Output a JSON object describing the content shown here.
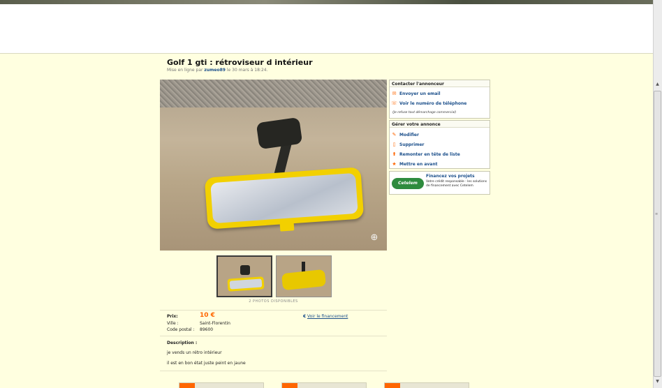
{
  "listing": {
    "title": "Golf 1 gti : rétroviseur d intérieur",
    "meta_prefix": "Mise en ligne par",
    "seller": "zumeo89",
    "meta_suffix": "le 30 mars à 18:24.",
    "photos_available": "2 PHOTOS DISPONIBLES"
  },
  "details": {
    "price_label": "Prix:",
    "price_value": "10 €",
    "city_label": "Ville :",
    "city_value": "Saint-Florentin",
    "postal_label": "Code postal :",
    "postal_value": "89600",
    "financing_link": "Voir le financement",
    "financing_icon": "euro-icon"
  },
  "description": {
    "title": "Description :",
    "lines": [
      "je vends un rétro intérieur",
      "il est en bon état juste peint en jaune"
    ]
  },
  "contact_box": {
    "header": "Contacter l'annonceur",
    "items": [
      {
        "label": "Envoyer un email",
        "icon": "envelope-icon"
      },
      {
        "label": "Voir le numéro de téléphone",
        "icon": "phone-icon"
      }
    ],
    "note": "(Je refuse tout démarchage commercial)"
  },
  "manage_box": {
    "header": "Gérer votre annonce",
    "items": [
      {
        "label": "Modifier",
        "icon": "pencil-icon"
      },
      {
        "label": "Supprimer",
        "icon": "trash-icon"
      },
      {
        "label": "Remonter en tête de liste",
        "icon": "arrow-up-icon"
      },
      {
        "label": "Mettre en avant",
        "icon": "star-icon"
      }
    ]
  },
  "cetelem": {
    "logo": "Cetelem",
    "title": "Financez vos projets",
    "text": "Votre crédit responsable : les solutions de financement avec Cetelem"
  },
  "colors": {
    "background": "#ffffe0",
    "link": "#1a4e8a",
    "accent": "#ff6600",
    "cetelem_green": "#2e8b3e"
  }
}
